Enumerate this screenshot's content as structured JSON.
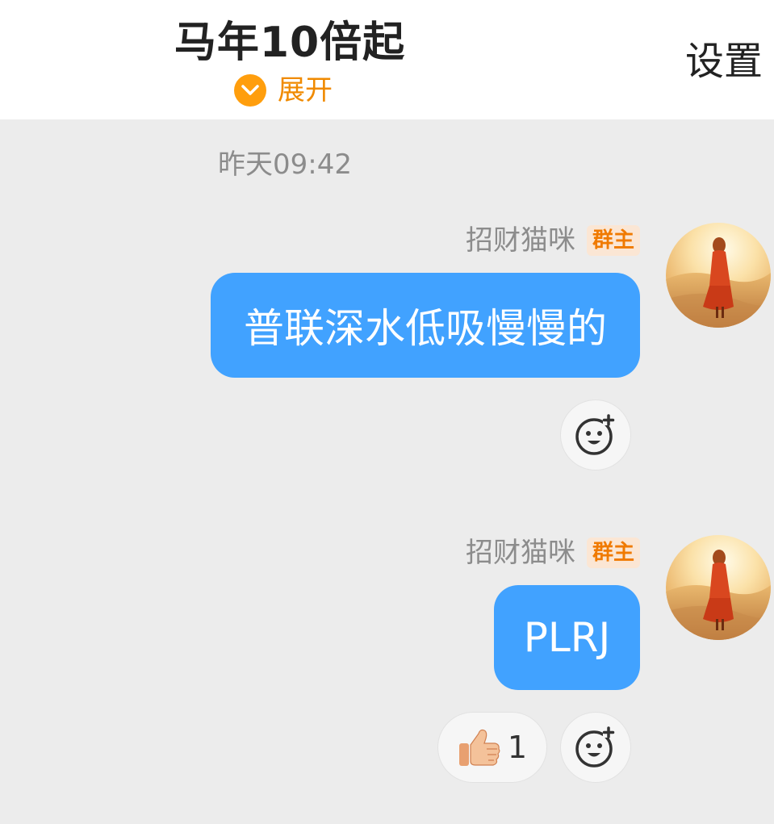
{
  "header": {
    "group_title": "马年10倍起",
    "expand_label": "展开",
    "settings_label": "设置"
  },
  "chat": {
    "timestamp": "昨天09:42",
    "messages": [
      {
        "sender": "招财猫咪",
        "role_badge": "群主",
        "text": "普联深水低吸慢慢的"
      },
      {
        "sender": "招财猫咪",
        "role_badge": "群主",
        "text": "PLRJ",
        "reactions": [
          {
            "icon": "thumbs-up-icon",
            "count": "1"
          }
        ]
      }
    ]
  },
  "colors": {
    "bubble": "#41a2ff",
    "accent": "#ff9e0d",
    "badge_text": "#f07a00",
    "background": "#ececec"
  }
}
